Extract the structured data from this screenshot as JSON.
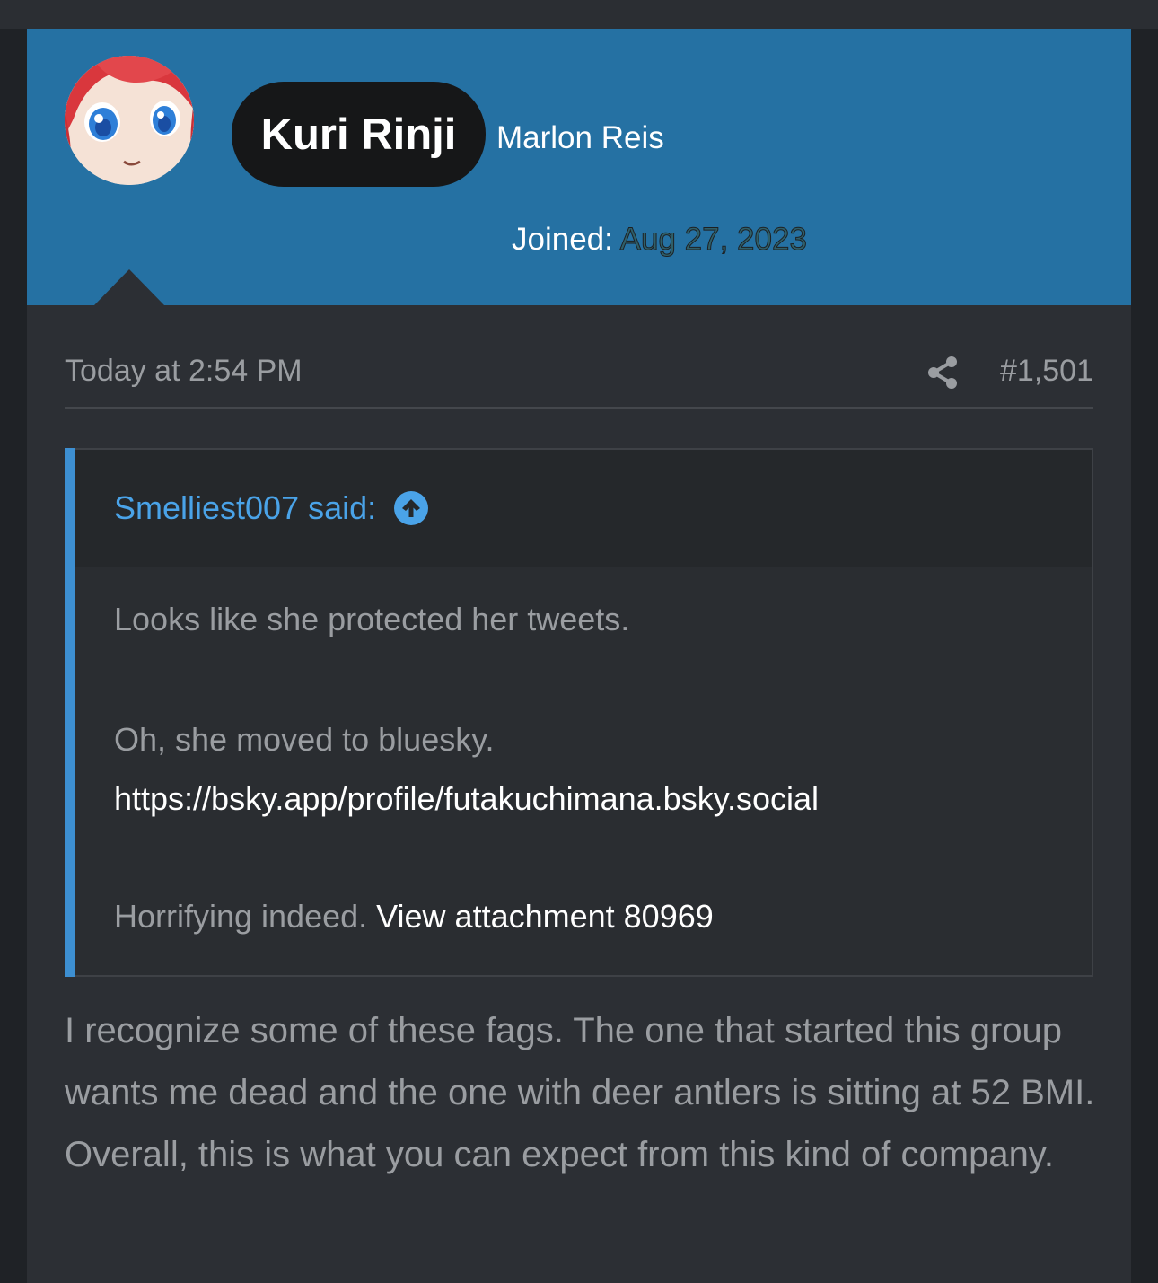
{
  "user": {
    "name": "Kuri Rinji",
    "title": "Marlon Reis",
    "joined_label": "Joined:",
    "joined_date": "Aug 27, 2023"
  },
  "post": {
    "timestamp": "Today at 2:54 PM",
    "number": "#1,501",
    "quote": {
      "author": "Smelliest007 said:",
      "line1": "Looks like she protected her tweets.",
      "line2": "Oh, she moved to bluesky.",
      "link": "https://bsky.app/profile/futakuchimana.bsky.social",
      "line3": "Horrifying indeed.",
      "attachment": "View attachment 80969"
    },
    "body": "I recognize some of these fags. The one that started this group wants me dead and the one with deer antlers is sitting at 52 BMI. Overall, this is what you can expect from this kind of company."
  },
  "icons": {
    "share": "share-icon",
    "goto": "arrow-up-circle-icon"
  },
  "colors": {
    "header": "#2571a3",
    "quote_accent": "#3d8fd1",
    "quote_author": "#4aa3e8",
    "background": "#2c2f34"
  }
}
